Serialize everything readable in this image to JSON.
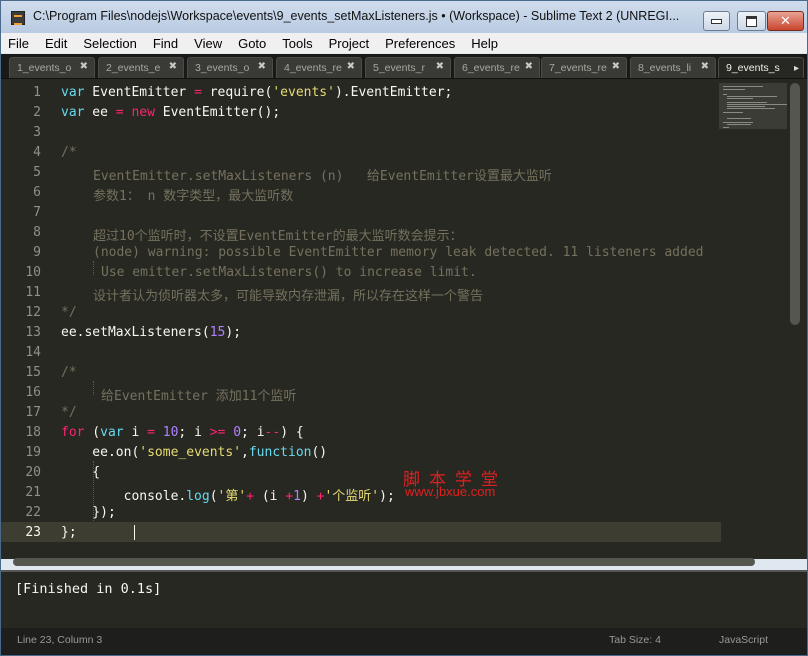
{
  "window": {
    "title": "C:\\Program Files\\nodejs\\Workspace\\events\\9_events_setMaxListeners.js • (Workspace) - Sublime Text 2 (UNREGI..."
  },
  "menu": [
    "File",
    "Edit",
    "Selection",
    "Find",
    "View",
    "Goto",
    "Tools",
    "Project",
    "Preferences",
    "Help"
  ],
  "tabs": [
    "1_events_o",
    "2_events_e",
    "3_events_o",
    "4_events_re",
    "5_events_r",
    "6_events_re",
    "7_events_re",
    "8_events_li",
    "9_events_s"
  ],
  "editor": {
    "line_numbers": [
      "1",
      "2",
      "3",
      "4",
      "5",
      "6",
      "7",
      "8",
      "9",
      "10",
      "11",
      "12",
      "13",
      "14",
      "15",
      "16",
      "17",
      "18",
      "19",
      "20",
      "21",
      "22",
      "23"
    ],
    "current_line": "23",
    "comments": {
      "l5": "EventEmitter.setMaxListeners (n)   给EventEmitter设置最大监听",
      "l6": "参数1： n 数字类型，最大监听数",
      "l8": "超过10个监听时，不设置EventEmitter的最大监听数会提示：",
      "l9": "(node) warning: possible EventEmitter memory leak detected. 11 listeners added",
      "l10": "Use emitter.setMaxListeners() to increase limit.",
      "l11": "设计者认为侦听器太多，可能导致内存泄漏，所以存在这样一个警告",
      "l16": "给EventEmitter 添加11个监听"
    }
  },
  "watermark": {
    "text": "脚本学堂",
    "url": "www.jbxue.com"
  },
  "output": {
    "text": "[Finished in 0.1s]"
  },
  "status": {
    "position": "Line 23, Column 3",
    "tab_size": "Tab Size: 4",
    "syntax": "JavaScript"
  },
  "colors": {
    "editor_bg": "#272822",
    "keyword": "#66d9ef",
    "operator": "#f92672",
    "string": "#e6db74",
    "number": "#ae81ff",
    "comment": "#75715e",
    "watermark": "#e02020"
  }
}
